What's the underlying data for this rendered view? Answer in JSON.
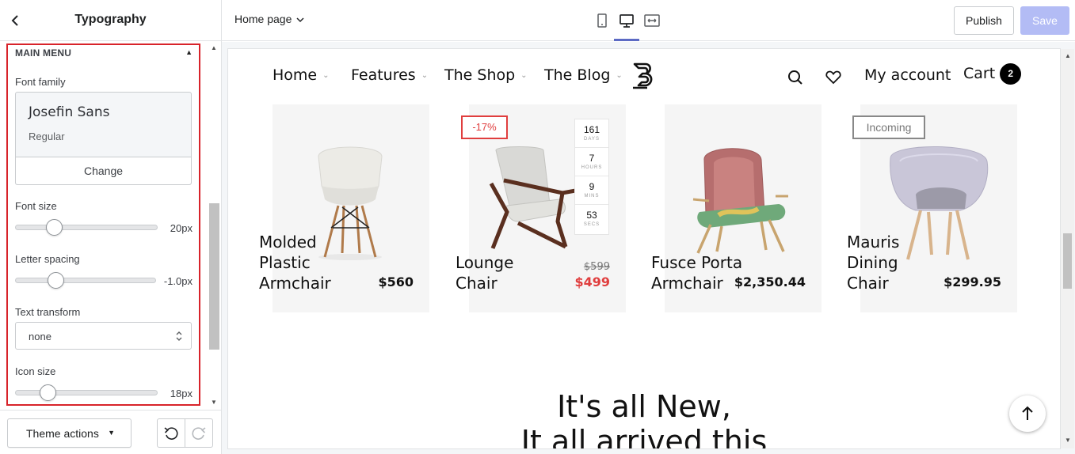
{
  "sidebar": {
    "title": "Typography",
    "section_title": "MAIN MENU",
    "font_family": {
      "label": "Font family",
      "name": "Josefin Sans",
      "style": "Regular",
      "change_label": "Change"
    },
    "font_size": {
      "label": "Font size",
      "value_label": "20px",
      "value": 20
    },
    "letter_spacing": {
      "label": "Letter spacing",
      "value_label": "-1.0px",
      "value": -1.0
    },
    "text_transform": {
      "label": "Text transform",
      "value": "none"
    },
    "icon_size": {
      "label": "Icon size",
      "value_label": "18px",
      "value": 18
    },
    "footer": {
      "theme_actions_label": "Theme actions"
    }
  },
  "topbar": {
    "page_select": "Home page",
    "active_device": "desktop",
    "publish_label": "Publish",
    "save_label": "Save"
  },
  "colors": {
    "highlight_border": "#d8232a",
    "save_button": "#b3bcf5",
    "device_underline": "#5c6ac4",
    "sale_red": "#e03e3e"
  },
  "preview": {
    "nav": {
      "items": [
        {
          "label": "Home"
        },
        {
          "label": "Features"
        },
        {
          "label": "The Shop"
        },
        {
          "label": "The Blog"
        }
      ],
      "account_label": "My account",
      "cart_label": "Cart",
      "cart_count": "2"
    },
    "products": [
      {
        "title_lines": [
          "Molded",
          "Plastic",
          "Armchair"
        ],
        "price": "$560"
      },
      {
        "title_lines": [
          "Lounge",
          "Chair"
        ],
        "old_price": "$599",
        "price": "$499",
        "badge": "-17%",
        "countdown": [
          {
            "value": "161",
            "unit": "DAYS"
          },
          {
            "value": "7",
            "unit": "HOURS"
          },
          {
            "value": "9",
            "unit": "MINS"
          },
          {
            "value": "53",
            "unit": "SECS"
          }
        ]
      },
      {
        "title_lines": [
          "Fusce Porta",
          "Armchair"
        ],
        "price": "$2,350.44"
      },
      {
        "title_lines": [
          "Mauris",
          "Dining",
          "Chair"
        ],
        "price": "$299.95",
        "badge": "Incoming"
      }
    ],
    "heading_line1": "It's all New,",
    "heading_line2": "It all arrived this"
  }
}
